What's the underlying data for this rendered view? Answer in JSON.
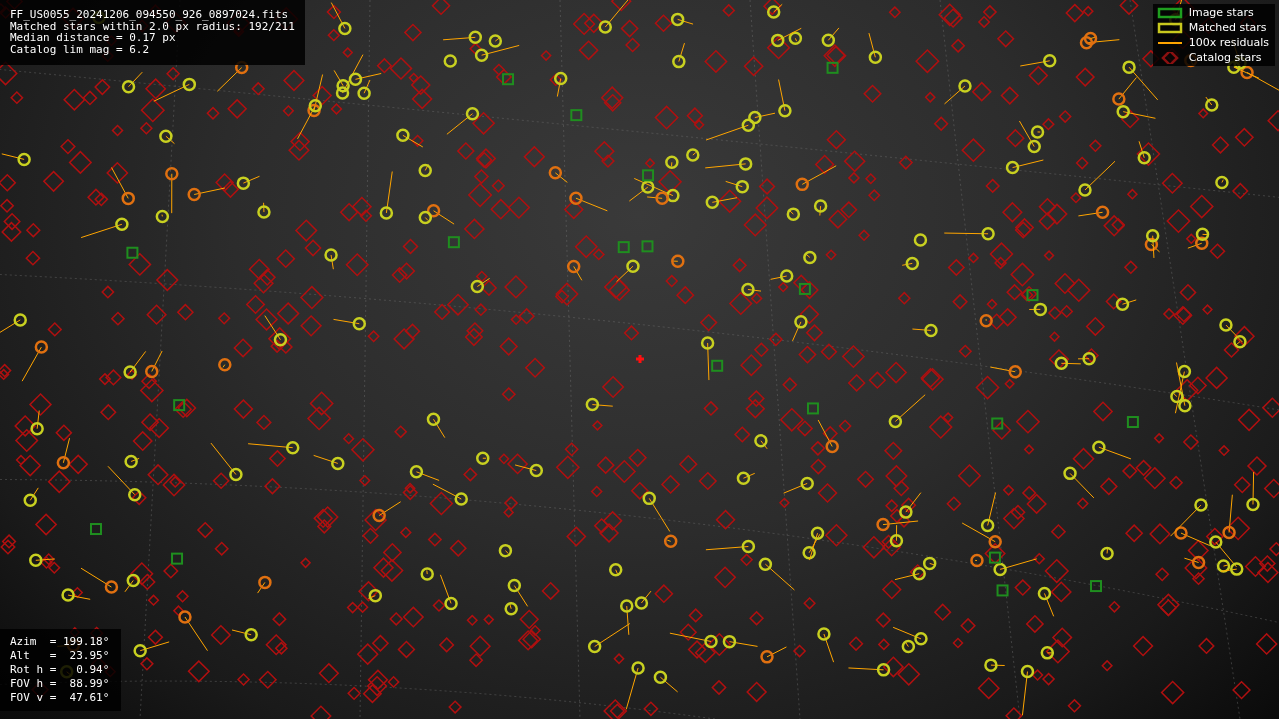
{
  "info_lines": [
    "FF_US0055_20241206_094550_926_0897024.fits",
    "Matched stars within 2.0 px radius: 192/211",
    "Median distance = 0.17 px",
    "Catalog lim mag = 6.2"
  ],
  "legend": [
    {
      "kind": "box",
      "color": "#1f9e1f",
      "label": "Image stars"
    },
    {
      "kind": "box",
      "color": "#c8c81e",
      "label": "Matched stars"
    },
    {
      "kind": "line",
      "color": "#ffa500",
      "label": "100x residuals"
    },
    {
      "kind": "diamond",
      "color": "#8a1010",
      "label": "Catalog stars"
    }
  ],
  "pointing_lines": [
    "Azim  = 199.18°",
    "Alt   =  23.95°",
    "Rot h =   0.94°",
    "FOV h =  88.99°",
    "FOV v =  47.61°"
  ]
}
